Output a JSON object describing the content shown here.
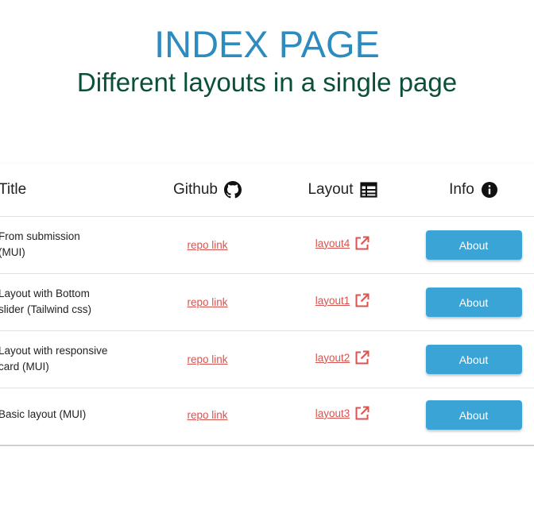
{
  "header": {
    "title": "INDEX PAGE",
    "subtitle": "Different layouts in a single page"
  },
  "table": {
    "columns": {
      "title": "Title",
      "github": "Github",
      "layout": "Layout",
      "info": "Info"
    },
    "rows": [
      {
        "title": "From submission (MUI)",
        "repo": "repo link",
        "layout": "layout4",
        "button": "About"
      },
      {
        "title": "Layout with Bottom slider (Tailwind css)",
        "repo": "repo link",
        "layout": "layout1",
        "button": "About"
      },
      {
        "title": "Layout with responsive card (MUI)",
        "repo": "repo link",
        "layout": "layout2",
        "button": "About"
      },
      {
        "title": "Basic layout (MUI)",
        "repo": "repo link",
        "layout": "layout3",
        "button": "About"
      }
    ]
  },
  "icons": {
    "github": "github-icon",
    "layout": "table-layout-icon",
    "info": "info-icon",
    "external": "external-link-icon"
  },
  "colors": {
    "title": "#2e8bc0",
    "subtitle": "#0b4f3b",
    "link": "#d9534f",
    "button": "#3aa4d6"
  }
}
